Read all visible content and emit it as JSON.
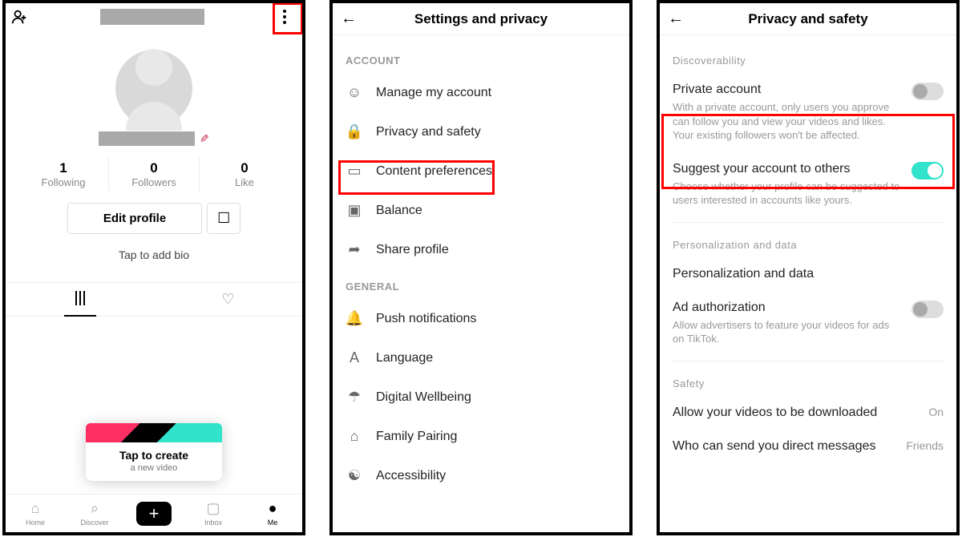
{
  "profile": {
    "stats": {
      "following": {
        "num": "1",
        "label": "Following"
      },
      "followers": {
        "num": "0",
        "label": "Followers"
      },
      "like": {
        "num": "0",
        "label": "Like"
      }
    },
    "editProfile": "Edit profile",
    "bio": "Tap to add bio",
    "popup": {
      "title": "Tap to create",
      "sub": "a new video"
    },
    "nav": {
      "home": "Home",
      "discover": "Discover",
      "inbox": "Inbox",
      "me": "Me"
    }
  },
  "settings": {
    "title": "Settings and privacy",
    "sections": {
      "account": "ACCOUNT",
      "general": "GENERAL"
    },
    "items": {
      "manage": "Manage my account",
      "privacy": "Privacy and safety",
      "content": "Content preferences",
      "balance": "Balance",
      "share": "Share profile",
      "push": "Push notifications",
      "language": "Language",
      "wellbeing": "Digital Wellbeing",
      "family": "Family Pairing",
      "accessibility": "Accessibility"
    }
  },
  "privacy": {
    "title": "Privacy and safety",
    "sections": {
      "discover": "Discoverability",
      "personal": "Personalization and data",
      "safety": "Safety"
    },
    "items": {
      "private": {
        "title": "Private account",
        "desc": "With a private account, only users you approve can follow you and view your videos and likes. Your existing followers won't be affected."
      },
      "suggest": {
        "title": "Suggest your account to others",
        "desc": "Choose whether your profile can be suggested to users interested in accounts like yours."
      },
      "personalization": {
        "title": "Personalization and data"
      },
      "adauth": {
        "title": "Ad authorization",
        "desc": "Allow advertisers to feature your videos for ads on TikTok."
      },
      "download": {
        "title": "Allow your videos to be downloaded",
        "value": "On"
      },
      "dm": {
        "title": "Who can send you direct messages",
        "value": "Friends"
      }
    }
  }
}
